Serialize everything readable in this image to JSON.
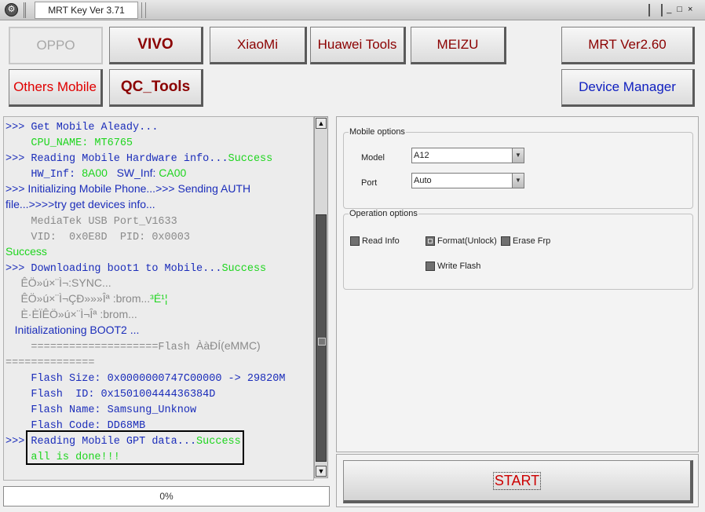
{
  "window": {
    "title": "MRT Key Ver 3.71",
    "controls": [
      "_",
      "□",
      "×"
    ]
  },
  "buttons": {
    "oppo": "OPPO",
    "vivo": "VIVO",
    "xiaomi": "XiaoMi",
    "huawei": "Huawei Tools",
    "meizu": "MEIZU",
    "mrt_ver": "MRT Ver2.60",
    "others": "Others Mobile",
    "qc_tools": "QC_Tools",
    "device_manager": "Device Manager",
    "start": "START"
  },
  "log": [
    {
      "parts": [
        {
          "t": ">>> Get Mobile Aleady...",
          "c": "blue",
          "m": true
        }
      ]
    },
    {
      "parts": [
        {
          "t": "    CPU_NAME: MT6765",
          "c": "green",
          "m": true
        }
      ]
    },
    {
      "parts": [
        {
          "t": ">>> Reading Mobile Hardware info...",
          "c": "blue",
          "m": true
        },
        {
          "t": "Success",
          "c": "green",
          "m": true
        }
      ]
    },
    {
      "parts": [
        {
          "t": "    HW_Inf: ",
          "c": "blue",
          "m": true
        },
        {
          "t": "8A00",
          "c": "green"
        },
        {
          "t": "   SW_Inf: ",
          "c": "blue"
        },
        {
          "t": "CA00",
          "c": "green"
        }
      ]
    },
    {
      "parts": [
        {
          "t": ">>> Initializing Mobile Phone...>>> Sending AUTH",
          "c": "blue"
        }
      ]
    },
    {
      "parts": [
        {
          "t": "file...>>>>try get devices info...",
          "c": "blue"
        }
      ]
    },
    {
      "parts": [
        {
          "t": "    MediaTek USB Port_V1633",
          "c": "gray",
          "m": true
        }
      ]
    },
    {
      "parts": [
        {
          "t": "    VID:  0x0E8D  PID: 0x0003",
          "c": "gray",
          "m": true
        }
      ]
    },
    {
      "parts": [
        {
          "t": "Success",
          "c": "green"
        }
      ]
    },
    {
      "parts": [
        {
          "t": ">>> Downloading boot1 to Mobile...",
          "c": "blue",
          "m": true
        },
        {
          "t": "Success",
          "c": "green",
          "m": true
        }
      ]
    },
    {
      "parts": [
        {
          "t": "     ÊÖ»ú×¨Ì¬:SYNC...",
          "c": "gray"
        }
      ]
    },
    {
      "parts": [
        {
          "t": "     ÊÖ»ú×¨Ì¬ÇÐ»»»Îª :brom...",
          "c": "gray"
        },
        {
          "t": "³É¹¦",
          "c": "green"
        }
      ]
    },
    {
      "parts": [
        {
          "t": "     È·ÈÏÊÖ»ú×¨Ì¬Îª :brom...",
          "c": "gray"
        }
      ]
    },
    {
      "parts": [
        {
          "t": "   Initializationing BOOT2 ...",
          "c": "blue"
        }
      ]
    },
    {
      "parts": [
        {
          "t": "    ====================Flash ",
          "c": "gray",
          "m": true
        },
        {
          "t": "ÀàÐÍ(eMMC)",
          "c": "gray"
        }
      ]
    },
    {
      "parts": [
        {
          "t": "==============",
          "c": "gray",
          "m": true
        }
      ]
    },
    {
      "parts": [
        {
          "t": "    Flash Size: 0x0000000747C00000 -> 29820M",
          "c": "blue",
          "m": true
        }
      ]
    },
    {
      "parts": [
        {
          "t": "    Flash  ID: 0x150100444436384D",
          "c": "blue",
          "m": true
        }
      ]
    },
    {
      "parts": [
        {
          "t": "    Flash Name: Samsung_Unknow",
          "c": "blue",
          "m": true
        }
      ]
    },
    {
      "parts": [
        {
          "t": "    Flash Code: DD68MB",
          "c": "blue",
          "m": true
        }
      ]
    },
    {
      "parts": [
        {
          "t": ">>> Reading Mobile GPT data...",
          "c": "blue",
          "m": true
        },
        {
          "t": "Success",
          "c": "green",
          "m": true
        }
      ]
    },
    {
      "parts": [
        {
          "t": "    all is done!!!",
          "c": "green",
          "m": true
        }
      ]
    }
  ],
  "progress": {
    "text": "0%",
    "fraction": 0
  },
  "mobile_options": {
    "title": "Mobile options",
    "model_label": "Model",
    "model_value": "A12",
    "port_label": "Port",
    "port_value": "Auto"
  },
  "operation_options": {
    "title": "Operation options",
    "read_info": "Read Info",
    "format": "Format(Unlock)",
    "erase_frp": "Erase Frp",
    "write_flash": "Write Flash",
    "format_checked": true
  },
  "colors": {
    "blue": "#1b2dba",
    "green": "#1ed51e",
    "gray": "#8a8a8a",
    "brand_red": "#8b0000"
  }
}
